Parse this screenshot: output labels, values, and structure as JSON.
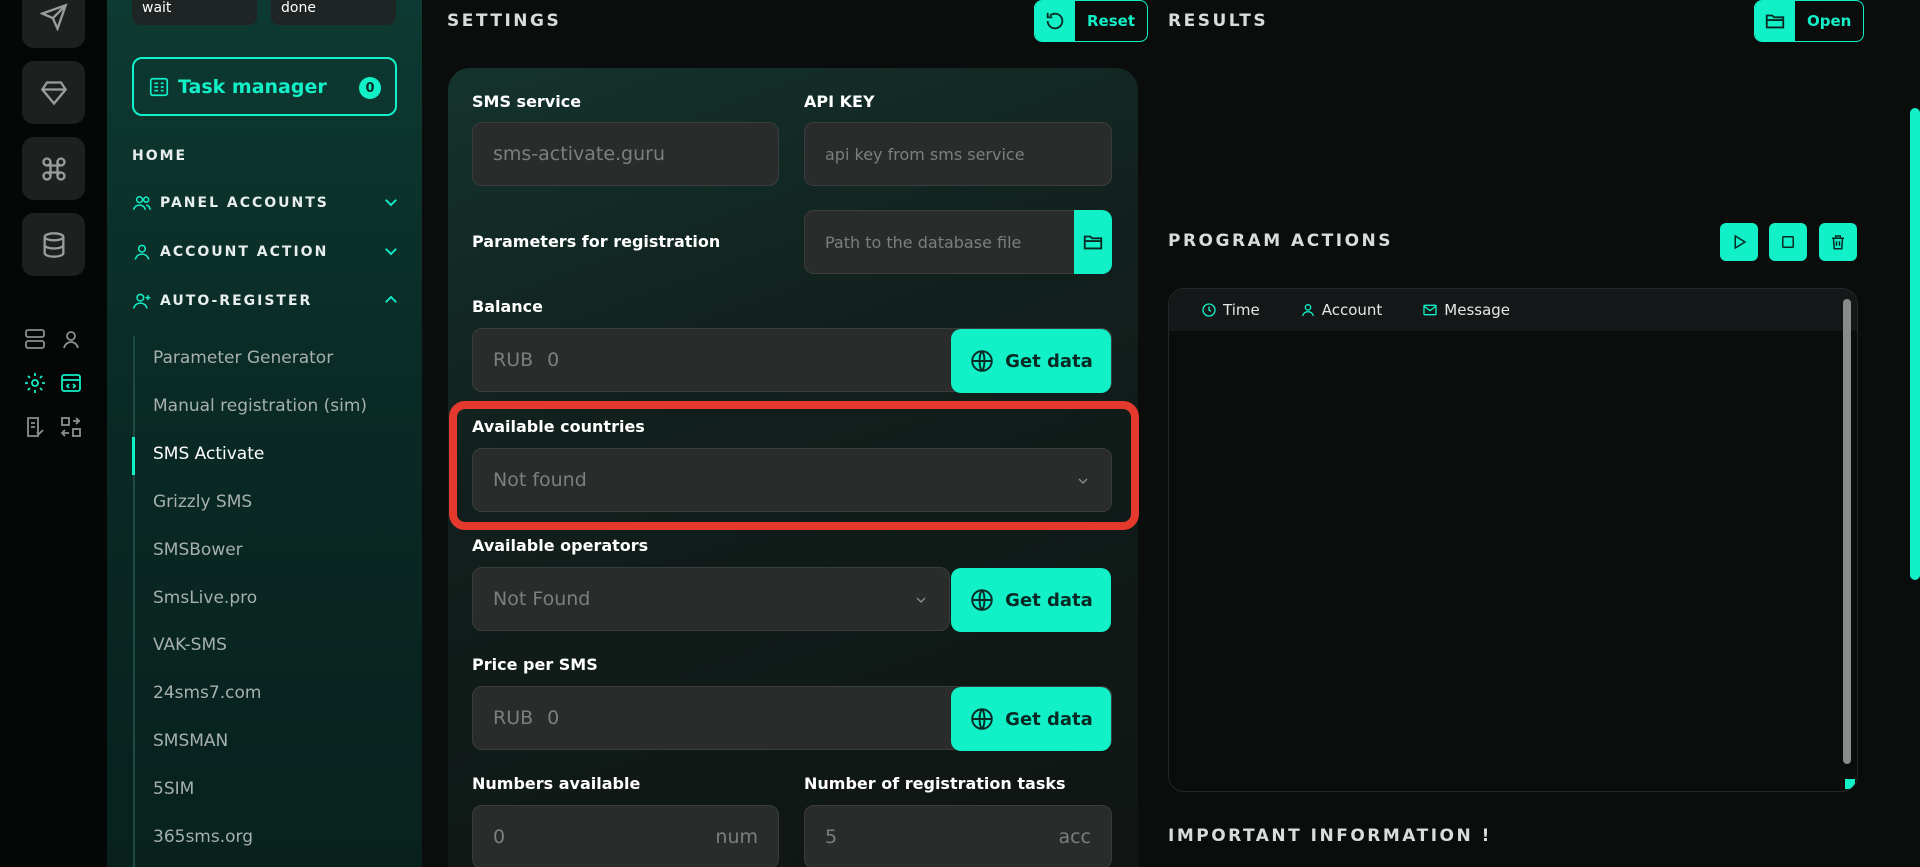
{
  "sidebar": {
    "stats": [
      {
        "label": "wait"
      },
      {
        "label": "done"
      }
    ],
    "task_manager": {
      "label": "Task manager",
      "count": "0"
    },
    "home": "HOME",
    "sections": [
      {
        "label": "PANEL ACCOUNTS",
        "icon": "users-icon",
        "expanded": false
      },
      {
        "label": "ACCOUNT ACTION",
        "icon": "user-icon",
        "expanded": false
      },
      {
        "label": "AUTO-REGISTER",
        "icon": "user-plus-icon",
        "expanded": true
      }
    ],
    "items": [
      {
        "label": "Parameter Generator"
      },
      {
        "label": "Manual registration (sim)"
      },
      {
        "label": "SMS Activate"
      },
      {
        "label": "Grizzly SMS"
      },
      {
        "label": "SMSBower"
      },
      {
        "label": "SmsLive.pro"
      },
      {
        "label": "VAK-SMS"
      },
      {
        "label": "24sms7.com"
      },
      {
        "label": "SMSMAN"
      },
      {
        "label": "5SIM"
      },
      {
        "label": "365sms.org"
      }
    ],
    "active_item": "SMS Activate"
  },
  "settings": {
    "title": "SETTINGS",
    "reset_label": "Reset",
    "sms_service": {
      "label": "SMS service",
      "value": "sms-activate.guru"
    },
    "api_key": {
      "label": "API KEY",
      "placeholder": "api key from sms service"
    },
    "registration_params": {
      "label": "Parameters for registration",
      "placeholder": "Path to the database file"
    },
    "balance": {
      "label": "Balance",
      "currency": "RUB",
      "value": "0",
      "button": "Get data"
    },
    "countries": {
      "label": "Available countries",
      "value": "Not found"
    },
    "operators": {
      "label": "Available operators",
      "value": "Not Found",
      "button": "Get data"
    },
    "price": {
      "label": "Price per SMS",
      "currency": "RUB",
      "value": "0",
      "button": "Get data"
    },
    "numbers": {
      "label": "Numbers available",
      "value": "0",
      "unit": "num"
    },
    "tasks": {
      "label": "Number of registration tasks",
      "value": "5",
      "unit": "acc"
    }
  },
  "results": {
    "title": "RESULTS",
    "open_label": "Open",
    "program_actions": "PROGRAM ACTIONS",
    "log_columns": [
      {
        "label": "Time"
      },
      {
        "label": "Account"
      },
      {
        "label": "Message"
      }
    ],
    "important_info": "IMPORTANT INFORMATION !"
  },
  "colors": {
    "accent": "#12f0c8",
    "highlight": "#e5392d",
    "background": "#0b0c0c"
  }
}
